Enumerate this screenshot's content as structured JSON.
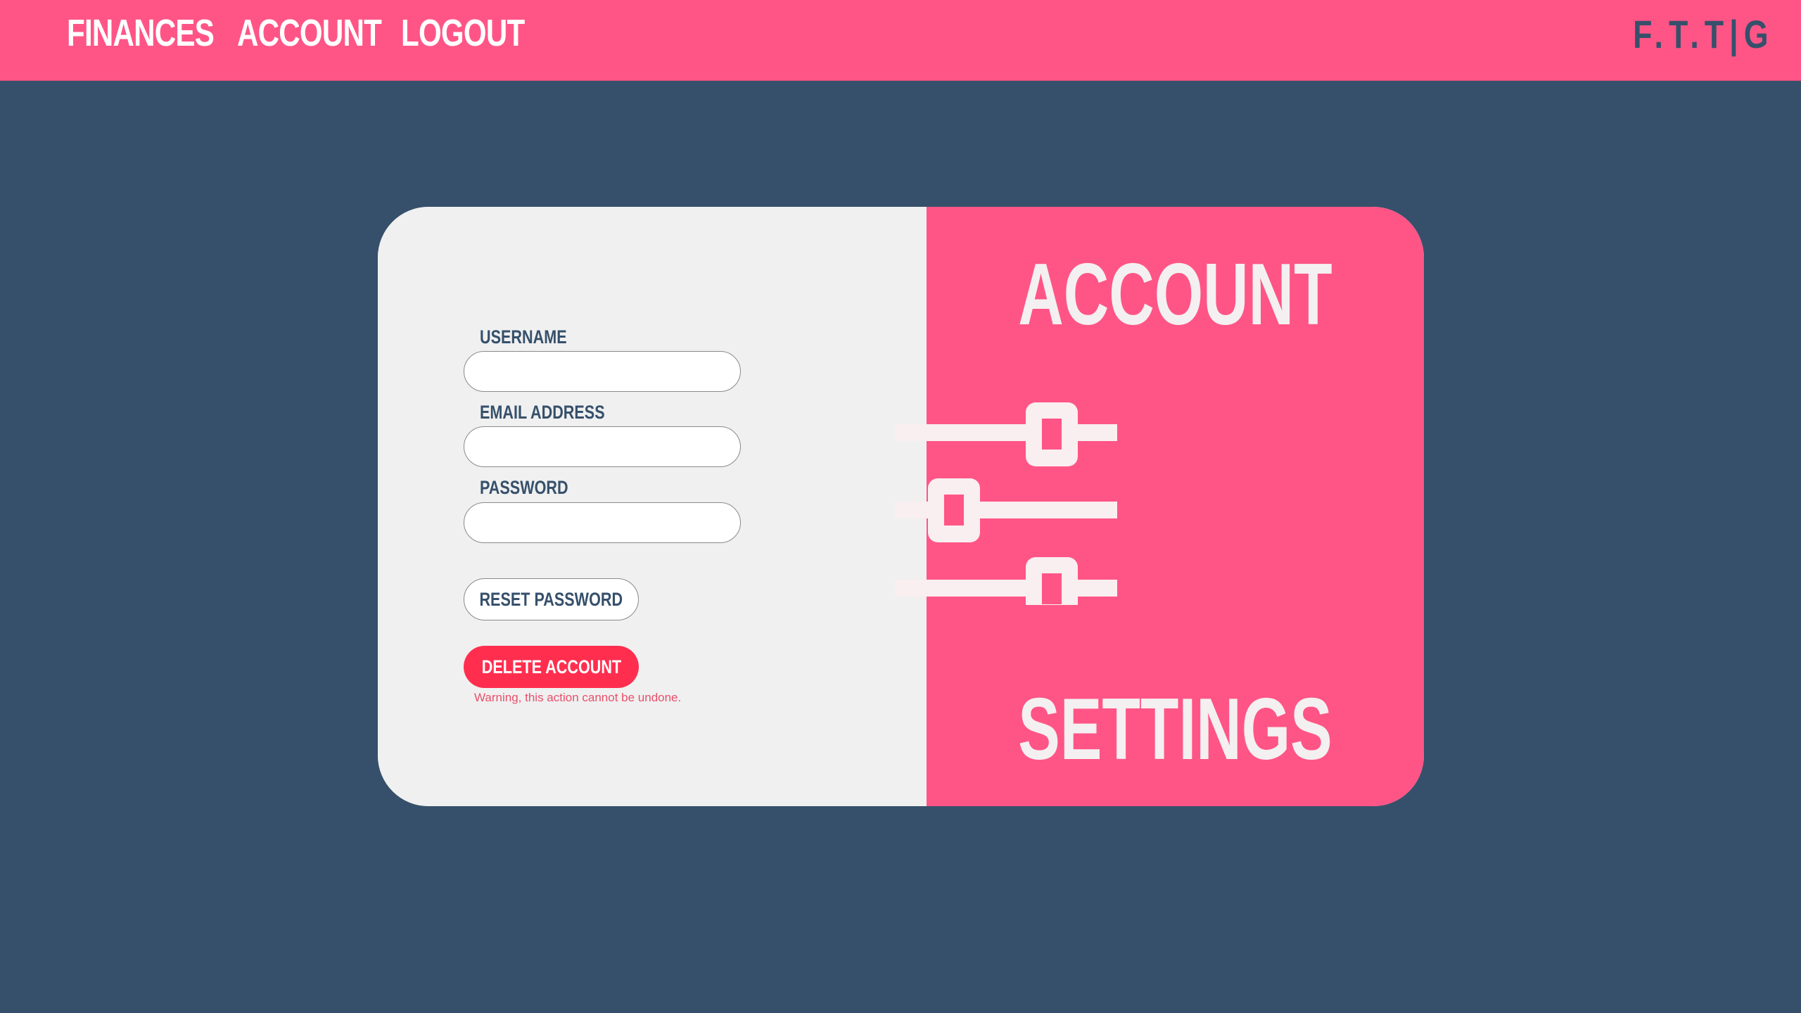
{
  "nav": {
    "items": [
      {
        "label": "FINANCES"
      },
      {
        "label": "ACCOUNT"
      },
      {
        "label": "LOGOUT"
      }
    ],
    "brand": "F.T.T|G"
  },
  "form": {
    "username_label": "USERNAME",
    "username_value": "",
    "email_label": "EMAIL ADDRESS",
    "email_value": "",
    "password_label": "PASSWORD",
    "password_value": "",
    "reset_button": "RESET PASSWORD",
    "delete_button": "DELETE ACCOUNT",
    "warning": "Warning, this action cannot be undone."
  },
  "panel": {
    "title_top": "ACCOUNT",
    "title_bottom": "SETTINGS",
    "icon": "sliders-icon"
  },
  "colors": {
    "accent": "#ff5586",
    "background": "#36506b",
    "card": "#f0f0f0",
    "danger": "#ff2e4f"
  }
}
